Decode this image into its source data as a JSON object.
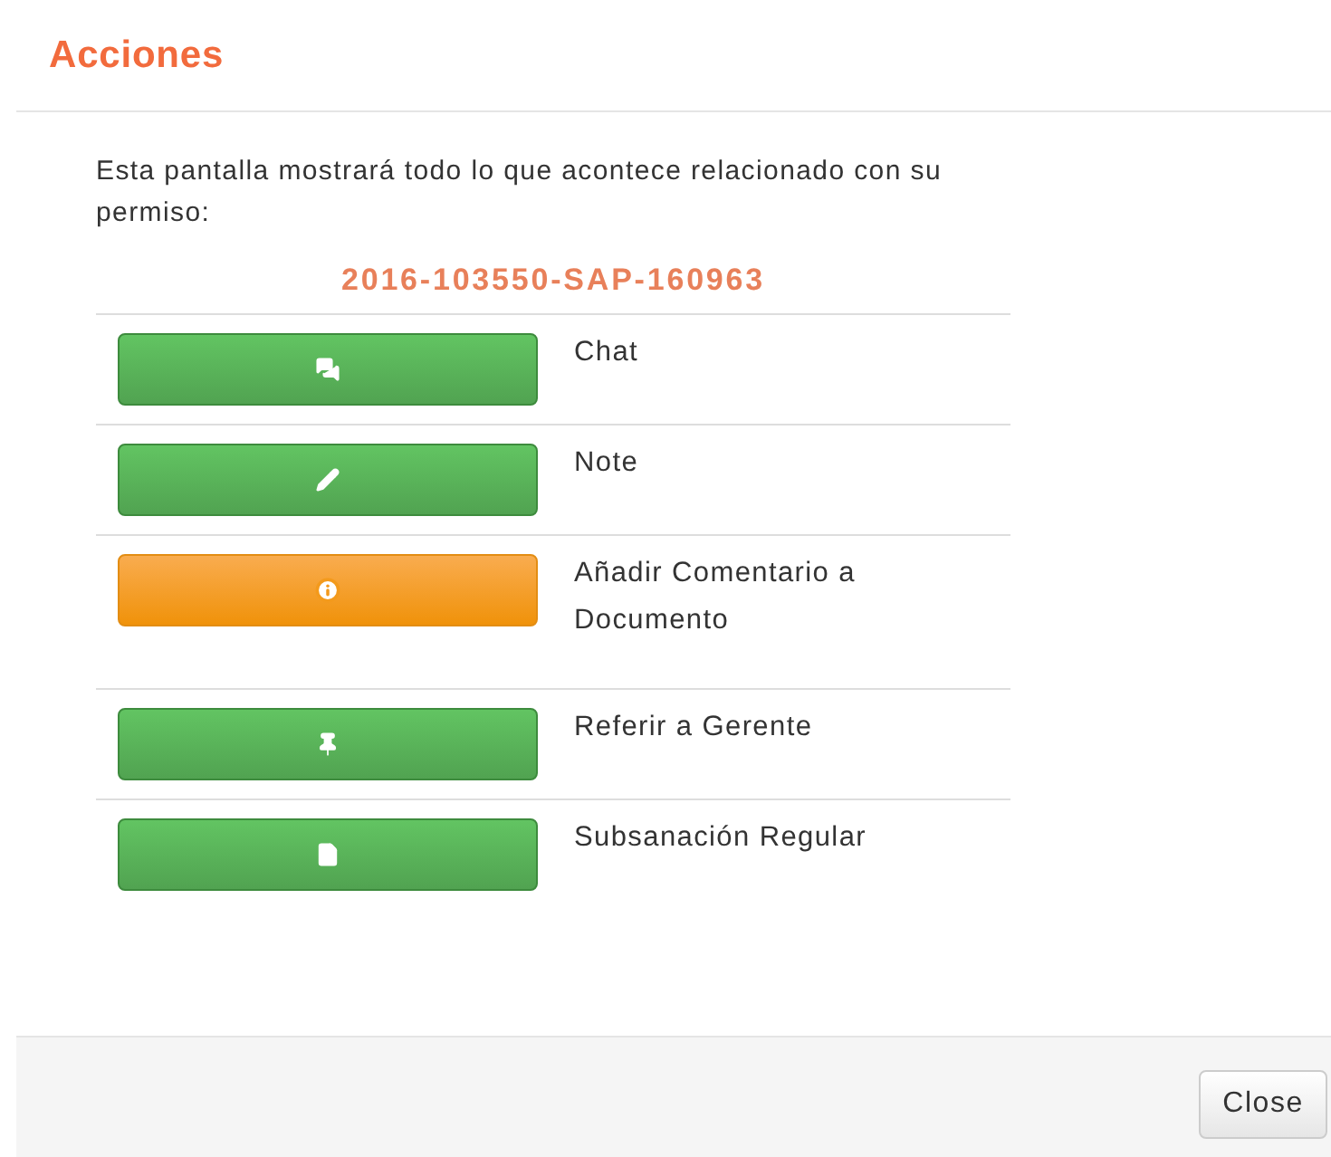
{
  "modal": {
    "title": "Acciones"
  },
  "intro": "Esta pantalla mostrará todo lo que acontece relacionado con su permiso:",
  "permit_number": "2016-103550-SAP-160963",
  "actions": [
    {
      "kind": "chat",
      "label": "Chat"
    },
    {
      "kind": "note",
      "label": "Note"
    },
    {
      "kind": "info",
      "label": "Añadir Comentario a Documento"
    },
    {
      "kind": "pin",
      "label": "Referir a Gerente"
    },
    {
      "kind": "file",
      "label": "Subsanación Regular"
    }
  ],
  "footer": {
    "close_button": "Close"
  }
}
